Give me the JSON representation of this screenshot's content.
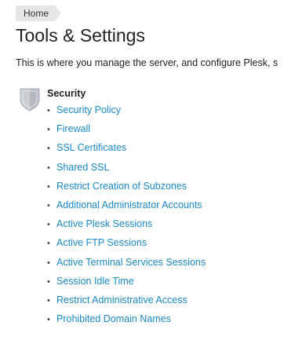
{
  "breadcrumb": {
    "home_label": "Home"
  },
  "page": {
    "title": "Tools & Settings",
    "description": "This is where you manage the server, and configure Plesk, s"
  },
  "section": {
    "title": "Security",
    "icon": "shield-icon",
    "link_color": "#1a8ac7",
    "links": [
      "Security Policy",
      "Firewall",
      "SSL Certificates",
      "Shared SSL",
      "Restrict Creation of Subzones",
      "Additional Administrator Accounts",
      "Active Plesk Sessions",
      "Active FTP Sessions",
      "Active Terminal Services Sessions",
      "Session Idle Time",
      "Restrict Administrative Access",
      "Prohibited Domain Names"
    ]
  }
}
